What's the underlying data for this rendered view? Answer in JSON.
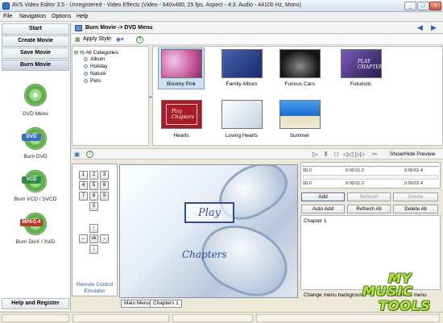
{
  "window": {
    "title": "AVS Video Editor 3.5 - Unregistered - Video Effects (Video - 640x480, 25 fps, Aspect - 4:3. Audio - 44100 Hz, Mono)"
  },
  "menu": [
    "File",
    "Navigation",
    "Options",
    "Help"
  ],
  "nav": {
    "start": "Start",
    "create_movie": "Create Movie",
    "save_movie": "Save Movie",
    "burn_movie": "Burn Movie",
    "help_register": "Help and Register",
    "items": [
      {
        "label": "DVD Menu",
        "tag": "",
        "color": "#5fb04a"
      },
      {
        "label": "Burn DVD",
        "tag": "DVD",
        "color": "#3a6fc4"
      },
      {
        "label": "Burn VCD / SVCD",
        "tag": "VCD",
        "color": "#2f8c4a"
      },
      {
        "label": "Burn DivX / XviD",
        "tag": "MPEG-4",
        "color": "#b83a2a"
      }
    ]
  },
  "breadcrumb": "Burn Movie -> DVD Menu",
  "toolbar": {
    "apply_style": "Apply Style",
    "view": "",
    "help": "?"
  },
  "tree": {
    "root": "All Categories",
    "children": [
      "Album",
      "Holiday",
      "Nature",
      "Pets"
    ]
  },
  "templates": [
    {
      "label": "Bloomy Pink",
      "thumb_text": "",
      "bg": "#c85a9c"
    },
    {
      "label": "Family Album",
      "thumb_text": "",
      "bg": "#2a3c84"
    },
    {
      "label": "Furious Cars",
      "thumb_text": "",
      "bg": "#101010"
    },
    {
      "label": "Futuristic",
      "thumb_text": "PLAY CHAPTERS",
      "bg": "#3a2a6a"
    },
    {
      "label": "Hearts",
      "thumb_text": "Play Chapters",
      "bg": "#a81c28"
    },
    {
      "label": "Loving Hearts",
      "thumb_text": "",
      "bg": "#d6dee8"
    },
    {
      "label": "Summer",
      "thumb_text": "",
      "bg": "#1a6ad0"
    }
  ],
  "playback": {
    "show_hide": "Show/Hide Preview"
  },
  "remote": {
    "keys": [
      "1",
      "2",
      "3",
      "4",
      "5",
      "6",
      "7",
      "8",
      "9",
      "0",
      "ok"
    ],
    "label_line1": "Remote Control",
    "label_line2": "Emulator"
  },
  "preview": {
    "play": "Play",
    "chapters": "Chapters"
  },
  "preview_tabs": [
    "Main Menu",
    "Chapters 1"
  ],
  "timeline": {
    "ticks_top": [
      "00.0",
      "0:00:01.2",
      "0:00:02.4"
    ],
    "ticks_bottom": [
      "00.0",
      "0:00:01.2",
      "0:00:02.4"
    ]
  },
  "actions": {
    "add": "Add",
    "refresh": "Refresh",
    "delete": "Delete",
    "auto_add": "Auto Add",
    "refresh_all": "Refresh All",
    "delete_all": "Delete All"
  },
  "chapters": [
    "Chapter 1"
  ],
  "bottom": {
    "change_bg": "Change menu background",
    "customize": "Customize menu"
  },
  "watermark": {
    "line1": "MY",
    "line2": "MUSIC",
    "line3": "TOOLS"
  }
}
